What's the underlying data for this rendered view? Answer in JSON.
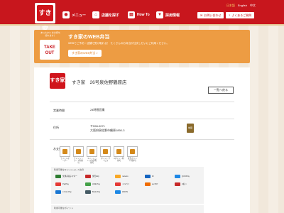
{
  "header": {
    "logo_text": "すき家",
    "nav": [
      {
        "label": "メニュー",
        "icon": "bowl-icon"
      },
      {
        "label": "店舗を探す",
        "icon": "store-icon"
      },
      {
        "label": "How To",
        "icon": "howto-icon"
      },
      {
        "label": "採用情報",
        "icon": "shirt-icon"
      }
    ],
    "lang": [
      "日本語",
      "English",
      "中文"
    ],
    "contact": "お問い合わせ",
    "faq": "よくあるご質問"
  },
  "banner": {
    "bubble": "あったかい まま持ち帰れます！",
    "bag_line1": "TAKE",
    "bag_line2": "OUT",
    "title": "すき家のWEB弁当",
    "desc": "WEBでご予約・店舗で受け取れる！ たくさんのお弁当が注文しだいにご利用ください。",
    "button": "すき家のWEB弁当 >"
  },
  "store": {
    "logo": "すき家",
    "title": "すき家　26号泉佐野鶴原店",
    "back": "一覧へ戻る",
    "hours_label": "営業時間",
    "hours": "24時間営業",
    "address_label": "住所",
    "zip": "〒598-0071",
    "address": "大阪府泉佐野市鶴原1850-3",
    "map": "地図",
    "payment_label": "お支払い",
    "payments": [
      "モバイルオーダー",
      "クレジットカード利用可",
      "キャッシュレス決済利用可",
      "ポイントサービス",
      "dポイント利用可",
      "楽天ポイント利用可"
    ],
    "epay_title": "利用可能なキャッシュレス決済",
    "epay": [
      {
        "name": "交通系電子マネー",
        "color": "#2e7d32"
      },
      {
        "name": "楽天Edy",
        "color": "#c62828"
      },
      {
        "name": "nanaco",
        "color": "#f9a825"
      },
      {
        "name": "iD",
        "color": "#1565c0"
      },
      {
        "name": "QUICPay",
        "color": "#1e88e5"
      },
      {
        "name": "PayPay",
        "color": "#e53935"
      },
      {
        "name": "LINE Pay",
        "color": "#43a047"
      },
      {
        "name": "メルペイ",
        "color": "#e53935"
      },
      {
        "name": "au PAY",
        "color": "#ef6c00"
      },
      {
        "name": "d払い",
        "color": "#c62828"
      },
      {
        "name": "J-Coin Pay",
        "color": "#1976d2"
      },
      {
        "name": "Bank Pay",
        "color": "#455a64"
      },
      {
        "name": "WAON",
        "color": "#1e88e5"
      }
    ],
    "points_title": "利用可能なポイント"
  }
}
